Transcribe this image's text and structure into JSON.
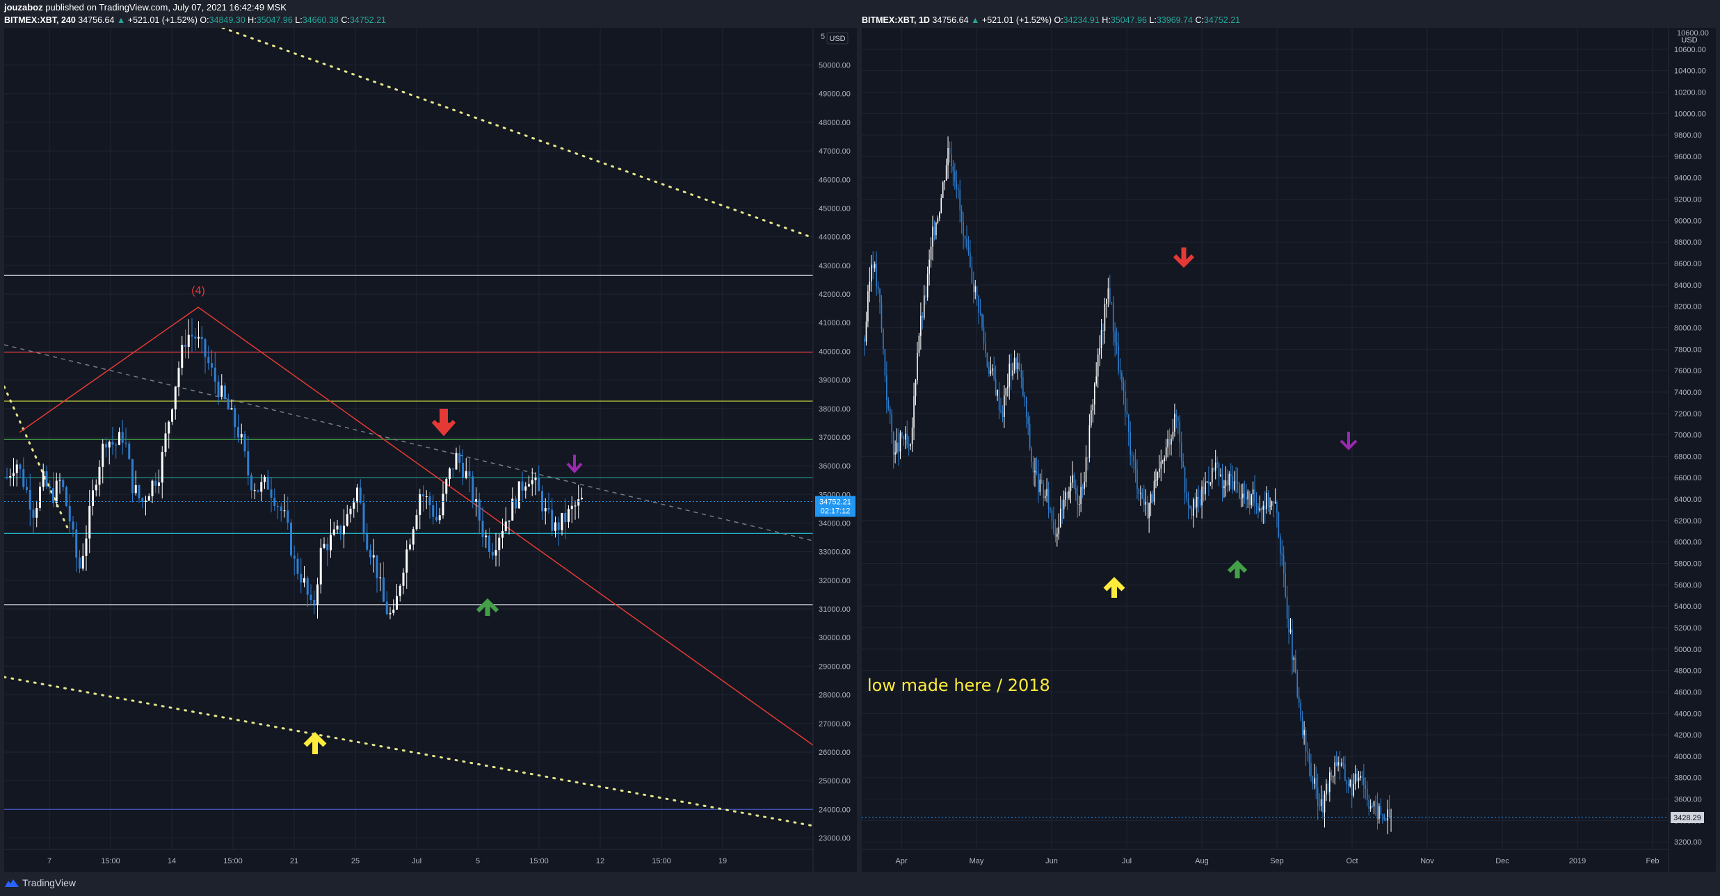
{
  "header": {
    "author": "jouzaboz",
    "published_text": "published on TradingView.com, July 07, 2021 16:42:49 MSK"
  },
  "footer": {
    "brand": "TradingView"
  },
  "colors": {
    "bg": "#131722",
    "frame": "#1e222d",
    "grid": "#1f2433",
    "text": "#b2b5be",
    "bull": "#ffffff",
    "bear": "#2d7fd1",
    "dotted": "#e6e68a",
    "red": "#e53935",
    "green": "#43a047",
    "yellow": "#ffeb3b",
    "purple": "#9c27b0",
    "accent_blue": "#2196f3"
  },
  "left_chart": {
    "symbol": "BITMEX:XBT, 240",
    "last": "34756.64",
    "change": "+521.01 (+1.52%)",
    "o_label": "O:",
    "o": "34849.30",
    "h_label": "H:",
    "h": "35047.96",
    "l_label": "L:",
    "l": "34660.38",
    "c_label": "C:",
    "c": "34752.21",
    "currency": "USD",
    "price_tag": "34752.21",
    "countdown": "02:17:12",
    "wave_label": "(4)",
    "top_tick": "5"
  },
  "right_chart": {
    "symbol": "BITMEX:XBT, 1D",
    "last": "34756.64",
    "change": "+521.01 (+1.52%)",
    "o_label": "O:",
    "o": "34234.91",
    "h_label": "H:",
    "h": "35047.96",
    "l_label": "L:",
    "l": "33969.74",
    "c_label": "C:",
    "c": "34752.21",
    "currency": "USD",
    "price_tag": "3428.29",
    "annotation": "low made here / 2018",
    "top_tick": "10600.00"
  },
  "chart_data": [
    {
      "type": "candlestick",
      "title": "BITMEX:XBT, 240",
      "ylim": [
        22600,
        51300
      ],
      "y_ticks": [
        23000,
        24000,
        25000,
        26000,
        27000,
        28000,
        29000,
        30000,
        31000,
        32000,
        33000,
        34000,
        35000,
        36000,
        37000,
        38000,
        39000,
        40000,
        41000,
        42000,
        43000,
        44000,
        45000,
        46000,
        47000,
        48000,
        49000,
        50000
      ],
      "x_tick_labels": [
        "7",
        "15:00",
        "14",
        "15:00",
        "21",
        "25",
        "Jul",
        "5",
        "15:00",
        "12",
        "15:00",
        "19"
      ],
      "price_line": 34752.21,
      "horizontal_levels": [
        {
          "price": 42650,
          "color": "#d1d4dc"
        },
        {
          "price": 39970,
          "color": "#e53935"
        },
        {
          "price": 38260,
          "color": "#cddc39"
        },
        {
          "price": 36920,
          "color": "#43a047"
        },
        {
          "price": 35580,
          "color": "#26a69a"
        },
        {
          "price": 33640,
          "color": "#26c6da"
        },
        {
          "price": 31150,
          "color": "#d1d4dc"
        },
        {
          "price": 24000,
          "color": "#3f51b5"
        }
      ],
      "close_path": [
        35600,
        36200,
        35300,
        34400,
        35500,
        34900,
        35500,
        34100,
        32300,
        33900,
        35800,
        37000,
        36700,
        37100,
        35300,
        34700,
        35300,
        35800,
        37600,
        39300,
        40600,
        40500,
        39900,
        39100,
        38400,
        37700,
        37000,
        35500,
        35200,
        35400,
        34800,
        34100,
        32600,
        32000,
        30800,
        33100,
        33400,
        33700,
        34300,
        35200,
        33500,
        32600,
        31100,
        30600,
        32400,
        33700,
        35100,
        34700,
        34000,
        35500,
        36300,
        35800,
        34800,
        33700,
        33100,
        33800,
        34400,
        35100,
        35700,
        35200,
        34300,
        33800,
        34100,
        34500,
        34752
      ]
    },
    {
      "type": "candlestick",
      "title": "BITMEX:XBT, 1D",
      "ylim": [
        3130,
        10800
      ],
      "y_ticks": [
        3200,
        3400,
        3600,
        3800,
        4000,
        4200,
        4400,
        4600,
        4800,
        5000,
        5200,
        5400,
        5600,
        5800,
        6000,
        6200,
        6400,
        6600,
        6800,
        7000,
        7200,
        7400,
        7600,
        7800,
        8000,
        8200,
        8400,
        8600,
        8800,
        9000,
        9200,
        9400,
        9600,
        9800,
        10000,
        10200,
        10400,
        10600
      ],
      "x_tick_labels": [
        "Apr",
        "May",
        "Jun",
        "Jul",
        "Aug",
        "Sep",
        "Oct",
        "Nov",
        "Dec",
        "2019",
        "Feb"
      ],
      "price_line": 3428.29,
      "close_path": [
        7900,
        8700,
        8200,
        7300,
        6800,
        7000,
        6800,
        7900,
        8300,
        8900,
        9200,
        9700,
        9400,
        8800,
        8500,
        8200,
        7700,
        7500,
        7200,
        7600,
        7700,
        7300,
        6700,
        6500,
        6400,
        6100,
        6300,
        6600,
        6400,
        6700,
        7400,
        7900,
        8400,
        7800,
        7300,
        6800,
        6500,
        6300,
        6500,
        6700,
        7000,
        7200,
        6500,
        6300,
        6400,
        6600,
        6700,
        6500,
        6600,
        6500,
        6400,
        6400,
        6350,
        6400,
        6300,
        5600,
        5000,
        4400,
        4000,
        3700,
        3500,
        3800,
        4000,
        3800,
        3700,
        3900,
        3600,
        3500,
        3450,
        3430
      ]
    }
  ]
}
